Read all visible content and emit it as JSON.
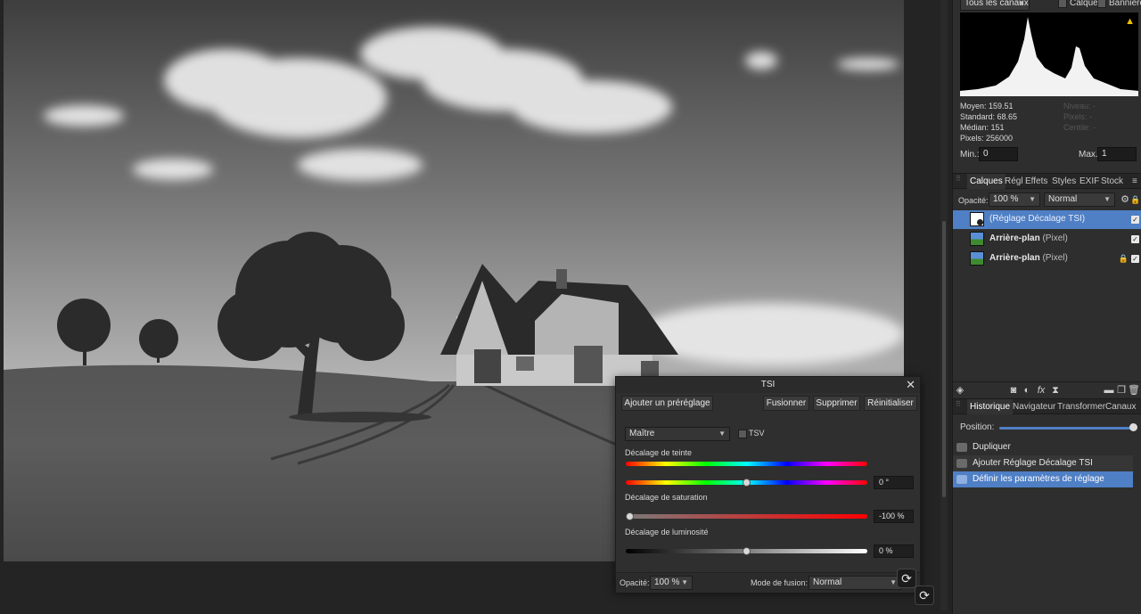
{
  "histogram": {
    "channel_select": "Tous les canaux",
    "layer_label": "Calque",
    "banner_label": "Bannière",
    "warning_icon": "warning-icon",
    "stats_left": [
      "Moyen: 159.51",
      "Standard: 68.65",
      "Médian: 151",
      "Pixels: 256000"
    ],
    "stats_right": [
      "Niveau: -",
      "Pixels: -",
      "Centile: -"
    ],
    "min_label": "Min.:",
    "min_value": "0",
    "max_label": "Max.:",
    "max_value": "1"
  },
  "layers_panel": {
    "tabs": [
      "Calques",
      "Régl",
      "Effets",
      "Styles",
      "EXIF",
      "Stock"
    ],
    "opacity_label": "Opacité:",
    "opacity_value": "100 %",
    "blend_mode": "Normal",
    "layers": [
      {
        "name": "(Réglage Décalage TSI)",
        "type": ""
      },
      {
        "name": "Arrière-plan",
        "type": "(Pixel)"
      },
      {
        "name": "Arrière-plan",
        "type": "(Pixel)"
      }
    ]
  },
  "history_panel": {
    "tabs": [
      "Historique",
      "Navigateur",
      "Transformer",
      "Canaux"
    ],
    "position_label": "Position:",
    "position_fraction": 1.0,
    "items": [
      "Dupliquer",
      "Ajouter Réglage Décalage TSI",
      "Définir les paramètres de réglage"
    ]
  },
  "tsi_dialog": {
    "title": "TSI",
    "add_preset": "Ajouter un préréglage",
    "merge": "Fusionner",
    "delete": "Supprimer",
    "reset": "Réinitialiser",
    "channel": "Maître",
    "tsv_label": "TSV",
    "hue_label": "Décalage de teinte",
    "hue_value": "0 °",
    "hue_fraction": 0.5,
    "saturation_label": "Décalage de saturation",
    "saturation_value": "-100 %",
    "saturation_fraction": 0.0,
    "luminosity_label": "Décalage de luminosité",
    "luminosity_value": "0 %",
    "luminosity_fraction": 0.5,
    "opacity_label": "Opacité:",
    "opacity_value": "100 %",
    "blend_label": "Mode de fusion:",
    "blend_value": "Normal"
  }
}
